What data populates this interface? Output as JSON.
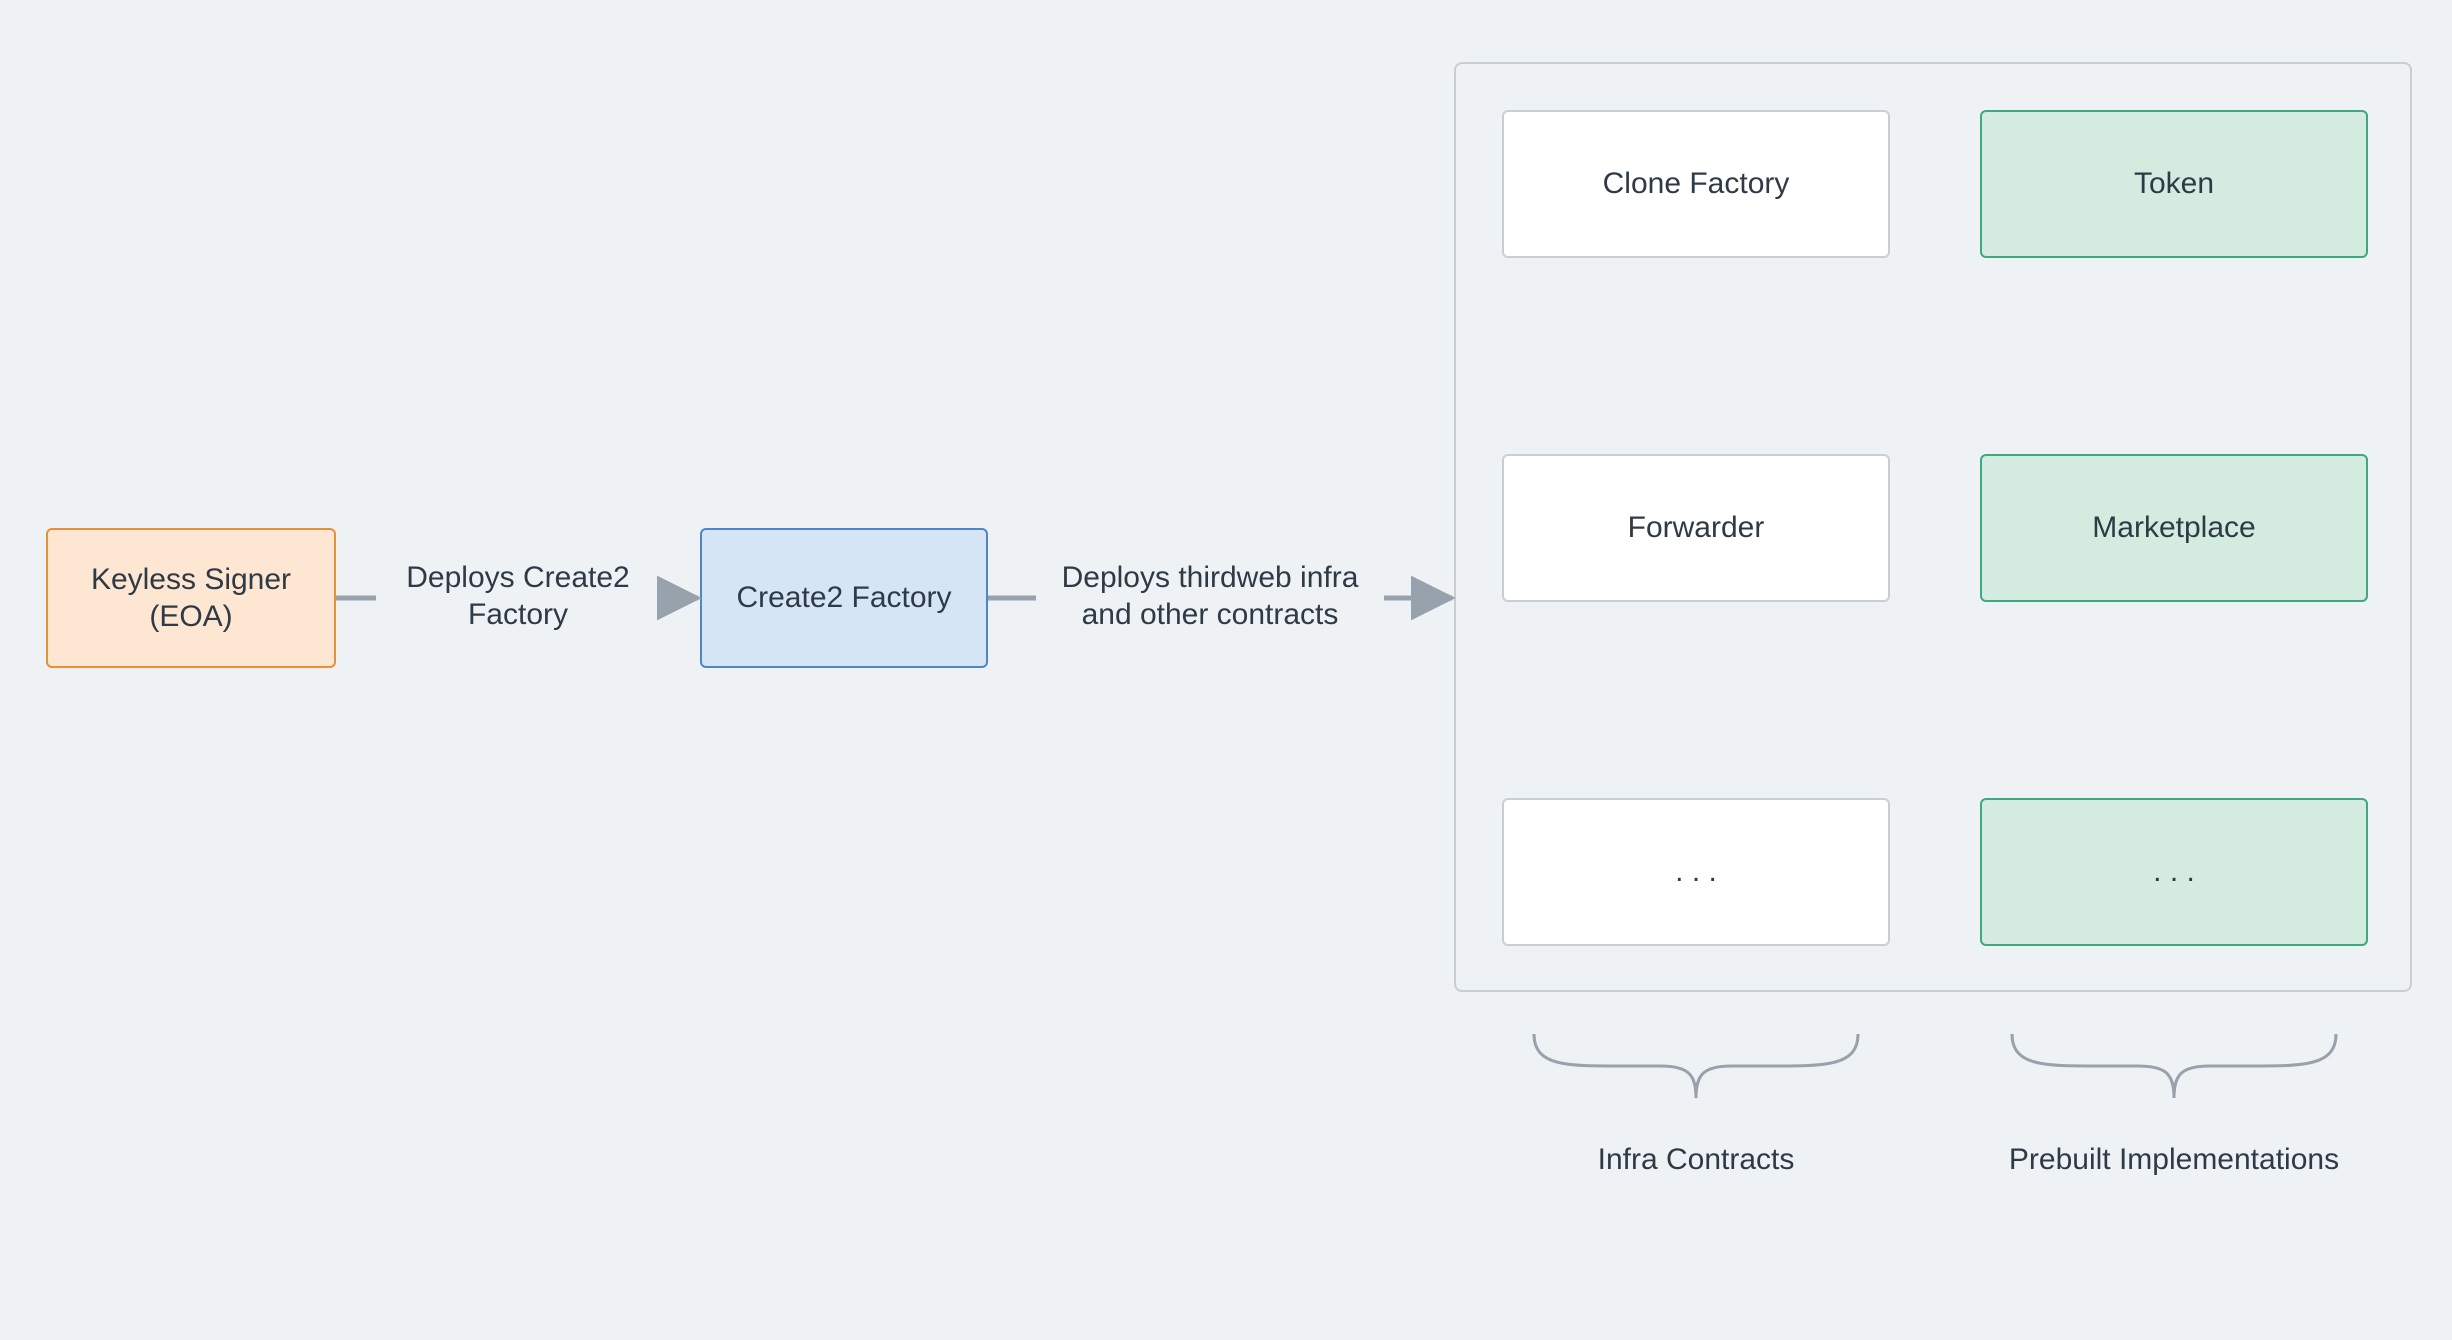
{
  "nodes": {
    "signer": "Keyless Signer (EOA)",
    "c2factory": "Create2 Factory",
    "clone_factory": "Clone Factory",
    "forwarder": "Forwarder",
    "infra_more": ". . .",
    "token": "Token",
    "marketplace": "Marketplace",
    "prebuilt_more": ". . ."
  },
  "edges": {
    "e1": "Deploys Create2 Factory",
    "e2": "Deploys thirdweb infra and other contracts"
  },
  "columns": {
    "infra": "Infra Contracts",
    "prebuilt": "Prebuilt Implementations"
  }
}
